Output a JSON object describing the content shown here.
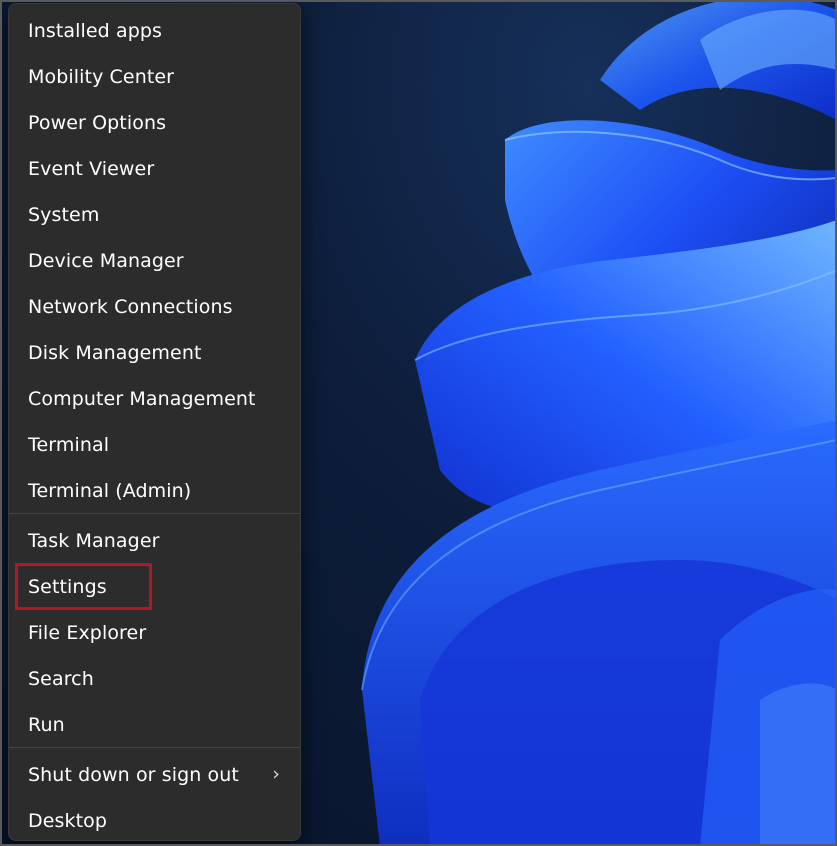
{
  "menu": {
    "groups": [
      {
        "items": [
          {
            "label": "Installed apps",
            "name": "menu-item-installed-apps"
          },
          {
            "label": "Mobility Center",
            "name": "menu-item-mobility-center"
          },
          {
            "label": "Power Options",
            "name": "menu-item-power-options"
          },
          {
            "label": "Event Viewer",
            "name": "menu-item-event-viewer"
          },
          {
            "label": "System",
            "name": "menu-item-system"
          },
          {
            "label": "Device Manager",
            "name": "menu-item-device-manager"
          },
          {
            "label": "Network Connections",
            "name": "menu-item-network-connections"
          },
          {
            "label": "Disk Management",
            "name": "menu-item-disk-management"
          },
          {
            "label": "Computer Management",
            "name": "menu-item-computer-management"
          },
          {
            "label": "Terminal",
            "name": "menu-item-terminal"
          },
          {
            "label": "Terminal (Admin)",
            "name": "menu-item-terminal-admin"
          }
        ]
      },
      {
        "items": [
          {
            "label": "Task Manager",
            "name": "menu-item-task-manager"
          },
          {
            "label": "Settings",
            "name": "menu-item-settings",
            "highlighted": true
          },
          {
            "label": "File Explorer",
            "name": "menu-item-file-explorer"
          },
          {
            "label": "Search",
            "name": "menu-item-search"
          },
          {
            "label": "Run",
            "name": "menu-item-run"
          }
        ]
      },
      {
        "items": [
          {
            "label": "Shut down or sign out",
            "name": "menu-item-shut-down-or-sign-out",
            "submenu": true,
            "submenu_icon": "chevron-right-icon"
          },
          {
            "label": "Desktop",
            "name": "menu-item-desktop"
          }
        ]
      }
    ]
  },
  "colors": {
    "menu_background": "#2c2c2c",
    "menu_text": "#ffffff",
    "highlight_box": "#b0182a",
    "wallpaper_accent": "#1f5cff"
  }
}
